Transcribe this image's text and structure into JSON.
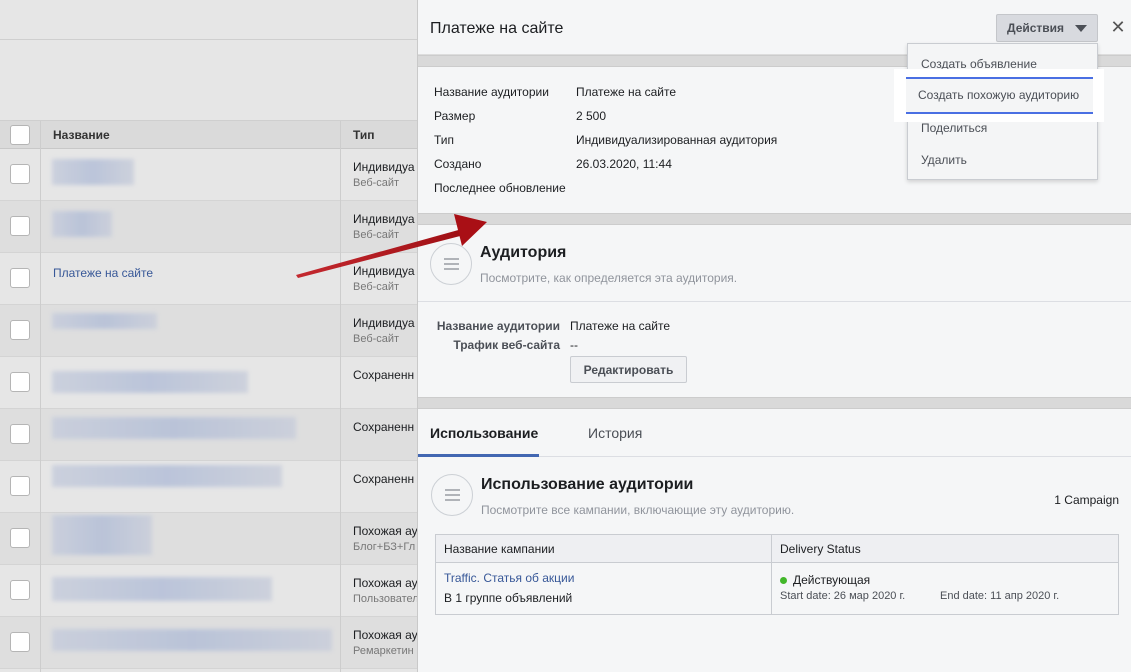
{
  "list": {
    "header": {
      "name": "Название",
      "type": "Тип"
    },
    "rows": [
      {
        "name": "",
        "type1": "Индивидуа",
        "type2": "Веб-сайт"
      },
      {
        "name": "",
        "type1": "Индивидуа",
        "type2": "Веб-сайт"
      },
      {
        "name": "Платеже на сайте",
        "type1": "Индивидуа",
        "type2": "Веб-сайт"
      },
      {
        "name": "",
        "type1": "Индивидуа",
        "type2": "Веб-сайт"
      },
      {
        "name": "",
        "type1": "Сохраненн",
        "type2": ""
      },
      {
        "name": "",
        "type1": "Сохраненн",
        "type2": ""
      },
      {
        "name": "",
        "type1": "Сохраненн",
        "type2": ""
      },
      {
        "name": "",
        "type1": "Похожая ау",
        "type2": "Блог+БЗ+Гл"
      },
      {
        "name": "",
        "type1": "Похожая ау",
        "type2": "Пользовател"
      },
      {
        "name": "",
        "type1": "Похожая ау",
        "type2": "Ремаркетин"
      }
    ]
  },
  "panel": {
    "title": "Платеже на сайте",
    "actions_label": "Действия",
    "close_glyph": "✕",
    "info": {
      "name_label": "Название аудитории",
      "name_value": "Платеже на сайте",
      "size_label": "Размер",
      "size_value": "2 500",
      "type_label": "Тип",
      "type_value": "Индивидуализированная аудитория",
      "created_label": "Создано",
      "created_value": "26.03.2020, 11:44",
      "updated_label": "Последнее обновление"
    },
    "audience": {
      "heading": "Аудитория",
      "subtitle": "Посмотрите, как определяется эта аудитория.",
      "name_key": "Название аудитории",
      "name_val": "Платеже на сайте",
      "traffic_key": "Трафик веб-сайта",
      "traffic_val": "--",
      "edit_label": "Редактировать"
    },
    "tabs": {
      "usage": "Использование",
      "history": "История"
    },
    "usage": {
      "heading": "Использование аудитории",
      "subtitle": "Посмотрите все кампании, включающие эту аудиторию.",
      "count": "1 Campaign",
      "col_name": "Название кампании",
      "col_status": "Delivery Status",
      "campaign_link": "Traffic. Статья об акции",
      "campaign_sub": "В 1 группе объявлений",
      "status": "Действующая",
      "start_date": "Start date: 26 мар 2020 г.",
      "end_date": "End date: 11 апр 2020 г."
    }
  },
  "menu": {
    "items": [
      "Создать объявление",
      "Создать похожую аудиторию",
      "Поделиться",
      "Удалить"
    ]
  },
  "colors": {
    "link": "#385898",
    "accent": "#4267b2",
    "highlight_border": "#4a6fe3",
    "arrow": "#c0141b",
    "status_ok": "#42b72a"
  }
}
